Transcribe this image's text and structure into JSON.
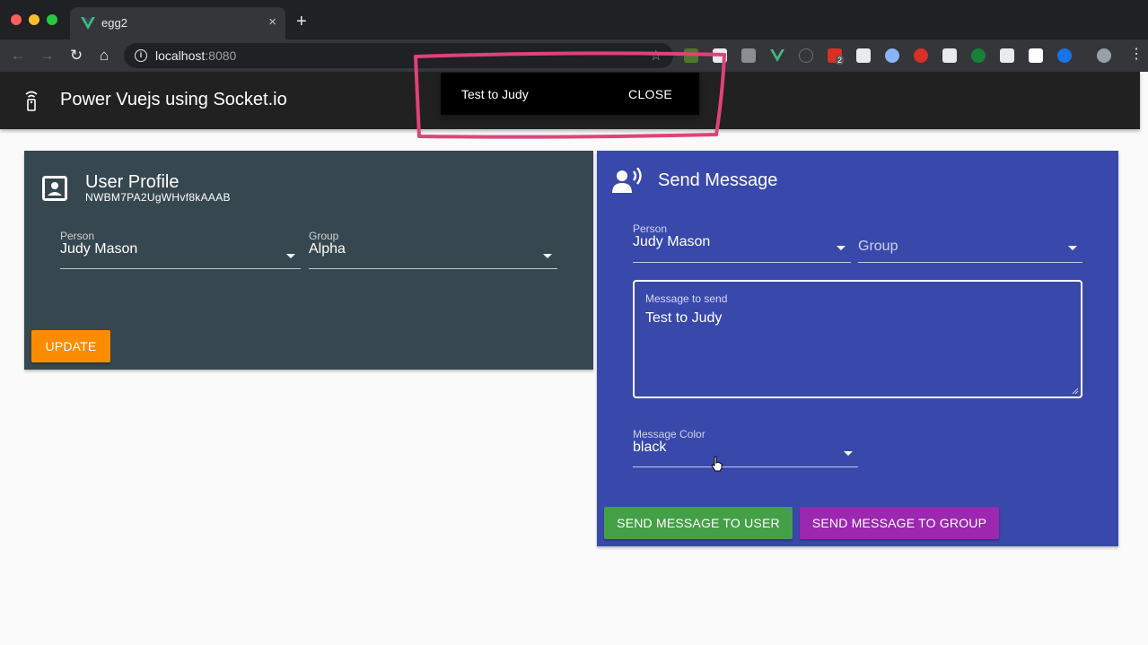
{
  "browser": {
    "tab_title": "egg2",
    "tab_close": "×",
    "new_tab": "+",
    "url_host": "localhost",
    "url_port": ":8080",
    "extensions_badge": "2"
  },
  "appbar": {
    "title": "Power Vuejs using Socket.io"
  },
  "snackbar": {
    "text": "Test to Judy",
    "close_label": "CLOSE"
  },
  "profile": {
    "title": "User Profile",
    "id": "NWBM7PA2UgWHvf8kAAAB",
    "person_label": "Person",
    "person_value": "Judy Mason",
    "group_label": "Group",
    "group_value": "Alpha",
    "update_label": "UPDATE"
  },
  "send": {
    "title": "Send Message",
    "person_label": "Person",
    "person_value": "Judy Mason",
    "group_placeholder": "Group",
    "message_label": "Message to send",
    "message_value": "Test to Judy",
    "color_label": "Message Color",
    "color_value": "black",
    "send_user_label": "SEND MESSAGE TO USER",
    "send_group_label": "SEND MESSAGE TO GROUP"
  },
  "colors": {
    "appbar": "#212121",
    "profile_card": "#37474f",
    "send_card": "#3949ab",
    "update_button": "#fb8c00",
    "send_user_button": "#43a047",
    "send_group_button": "#9c27b0",
    "annotation": "#e0427a"
  }
}
